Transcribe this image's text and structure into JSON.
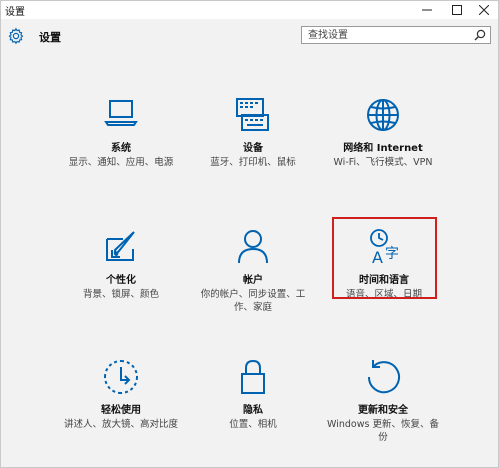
{
  "window": {
    "title": "设置",
    "controls": [
      "minimize-icon",
      "maximize-icon",
      "close-icon"
    ]
  },
  "header": {
    "title": "设置",
    "search_placeholder": "查找设置"
  },
  "colors": {
    "accent": "#0063b1",
    "highlight_border": "#d01f1f"
  },
  "tiles": [
    {
      "label": "系统",
      "desc": "显示、通知、应用、电源",
      "icon": "laptop-icon"
    },
    {
      "label": "设备",
      "desc": "蓝牙、打印机、鼠标",
      "icon": "keyboard-icon"
    },
    {
      "label": "网络和 Internet",
      "desc": "Wi-Fi、飞行模式、VPN",
      "icon": "globe-icon"
    },
    {
      "label": "个性化",
      "desc": "背景、锁屏、颜色",
      "icon": "brush-icon"
    },
    {
      "label": "帐户",
      "desc": "你的帐户、同步设置、工作、家庭",
      "icon": "person-icon"
    },
    {
      "label": "时间和语言",
      "desc": "语音、区域、日期",
      "icon": "time-language-icon"
    },
    {
      "label": "轻松使用",
      "desc": "讲述人、放大镜、高对比度",
      "icon": "ease-of-access-icon"
    },
    {
      "label": "隐私",
      "desc": "位置、相机",
      "icon": "lock-icon"
    },
    {
      "label": "更新和安全",
      "desc": "Windows 更新、恢复、备份",
      "icon": "refresh-icon"
    }
  ]
}
